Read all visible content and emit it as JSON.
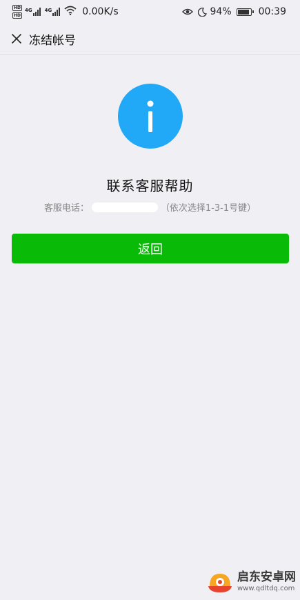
{
  "status_bar": {
    "hd_labels": [
      "HD",
      "HD"
    ],
    "sim1_tag": "4G",
    "sim2_tag": "4G",
    "net_speed": "0.00K/s",
    "battery_percent": "94%",
    "time": "00:39",
    "icons": [
      "eye-icon",
      "moon-icon",
      "wifi-icon",
      "battery-icon"
    ]
  },
  "header": {
    "title": "冻结帐号"
  },
  "main": {
    "help_title": "联系客服帮助",
    "phone_label": "客服电话：",
    "phone_hint": "（依次选择1-3-1号键）",
    "back_label": "返回"
  },
  "colors": {
    "accent_green": "#09bb07",
    "info_blue": "#21a9f7",
    "background": "#efeff4"
  },
  "watermark": {
    "name": "启东安卓网",
    "url": "www.qdltdq.com"
  }
}
